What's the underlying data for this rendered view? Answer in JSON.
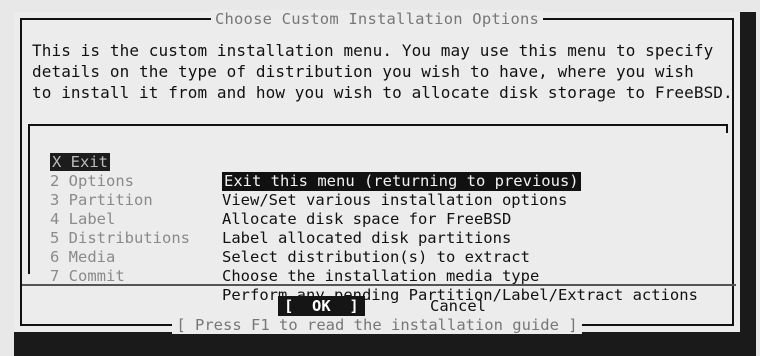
{
  "dialog": {
    "title": "Choose Custom Installation Options",
    "description": [
      "This is the custom installation menu. You may use this menu to specify",
      "details on the type of distribution you wish to have, where you wish",
      "to install it from and how you wish to allocate disk storage to FreeBSD."
    ],
    "help_hint": "[ Press F1 to read the installation guide ]"
  },
  "menu": {
    "items": [
      {
        "key": "X Exit",
        "desc": "Exit this menu (returning to previous)",
        "selected": true
      },
      {
        "key": "2 Options",
        "desc": "View/Set various installation options"
      },
      {
        "key": "3 Partition",
        "desc": "Allocate disk space for FreeBSD"
      },
      {
        "key": "4 Label",
        "desc": "Label allocated disk partitions"
      },
      {
        "key": "5 Distributions",
        "desc": "Select distribution(s) to extract"
      },
      {
        "key": "6 Media",
        "desc": "Choose the installation media type"
      },
      {
        "key": "7 Commit",
        "desc": "Perform any pending Partition/Label/Extract actions"
      }
    ]
  },
  "buttons": {
    "ok": "[  OK  ]",
    "cancel": "Cancel"
  }
}
